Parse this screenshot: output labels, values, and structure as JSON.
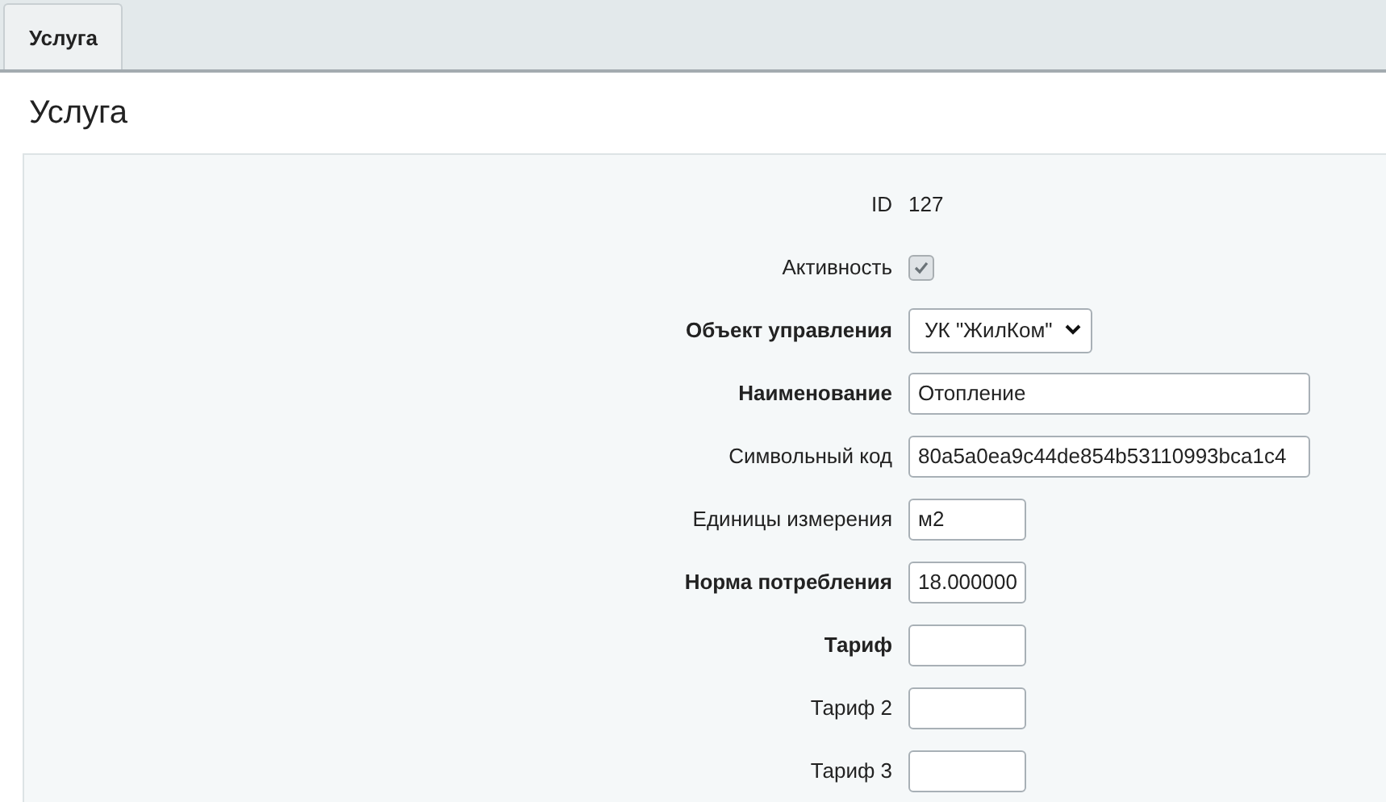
{
  "tabs": [
    {
      "label": "Услуга",
      "selected": true
    }
  ],
  "title": "Услуга",
  "fields": [
    {
      "kind": "text",
      "label": "ID",
      "bold": false,
      "value": "127"
    },
    {
      "kind": "checkbox",
      "label": "Активность",
      "bold": false,
      "checked": true
    },
    {
      "kind": "select",
      "label": "Объект управления",
      "bold": true,
      "value": "УК \"ЖилКом\""
    },
    {
      "kind": "input",
      "label": "Наименование",
      "bold": true,
      "value": "Отопление",
      "wide": true
    },
    {
      "kind": "input",
      "label": "Символьный код",
      "bold": false,
      "value": "80a5a0ea9c44de854b53110993bca1c4",
      "wide": true
    },
    {
      "kind": "input",
      "label": "Единицы измерения",
      "bold": false,
      "value": "м2",
      "wide": false
    },
    {
      "kind": "input",
      "label": "Норма потребления",
      "bold": true,
      "value": "18.000000",
      "wide": false
    },
    {
      "kind": "input",
      "label": "Тариф",
      "bold": true,
      "wide": false
    },
    {
      "kind": "input",
      "label": "Тариф 2",
      "bold": false,
      "wide": false
    },
    {
      "kind": "input",
      "label": "Тариф 3",
      "bold": false,
      "wide": false
    }
  ]
}
